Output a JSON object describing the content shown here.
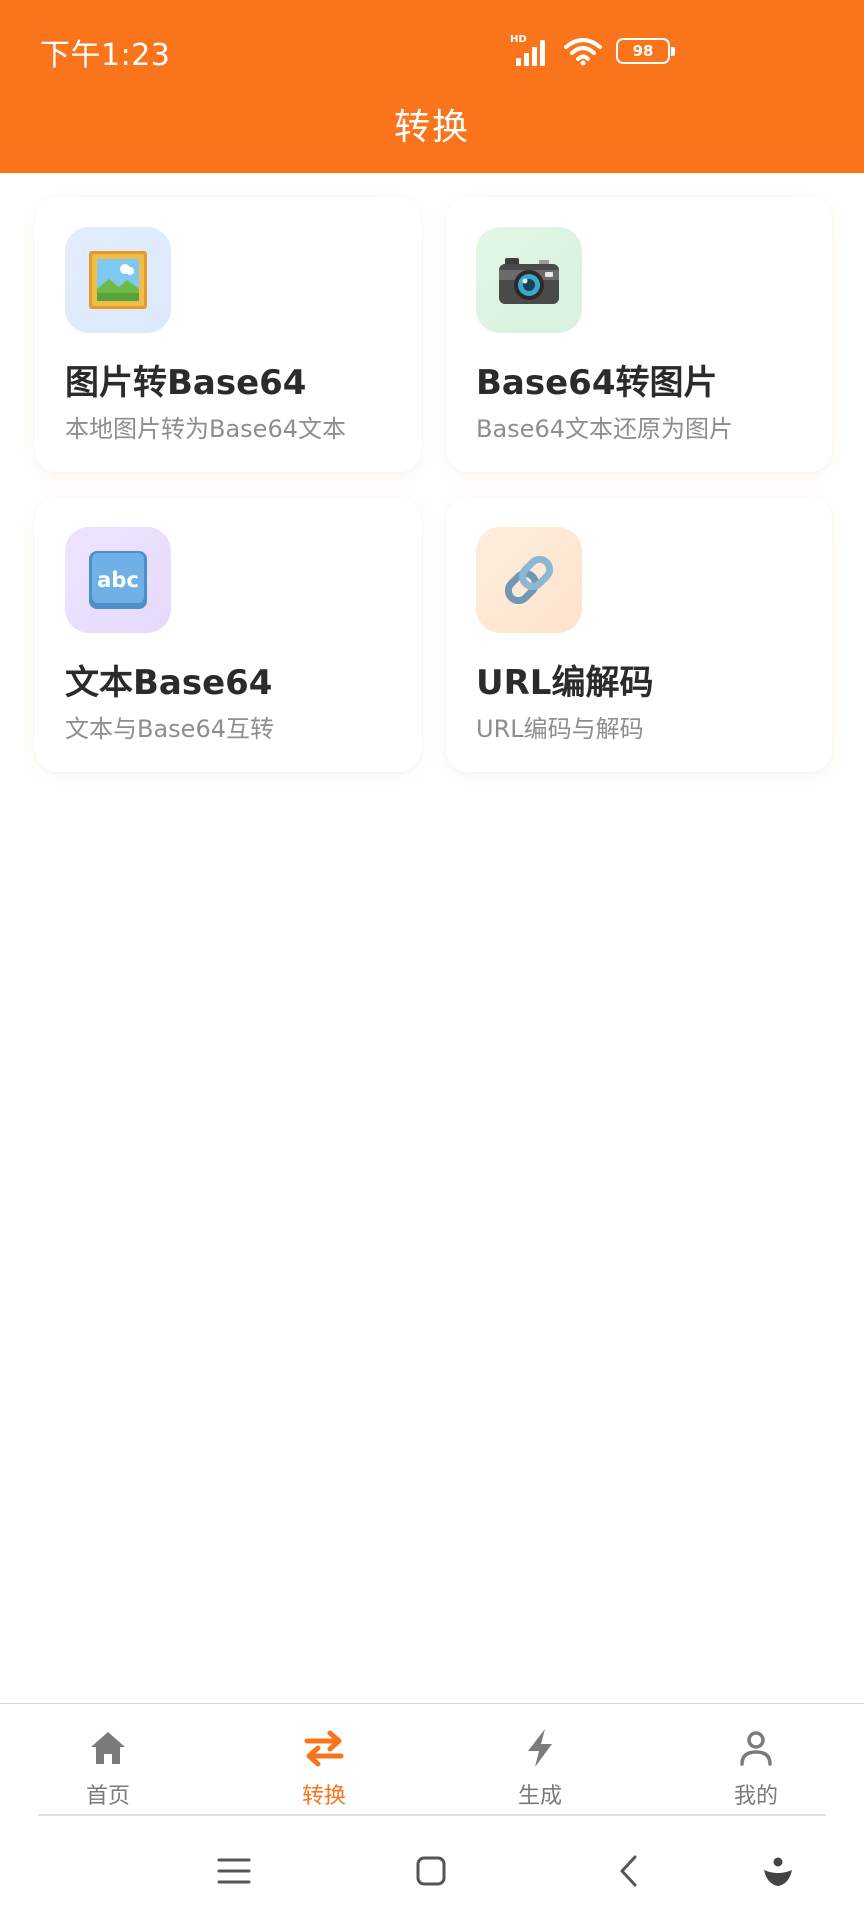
{
  "status_bar": {
    "time": "下午1:23",
    "network_badge": "HD",
    "battery_level": "98",
    "icons": [
      "signal-icon",
      "wifi-icon",
      "battery-icon"
    ]
  },
  "header": {
    "title": "转换",
    "background_color": "#F9741B"
  },
  "cards": [
    {
      "icon": "framed-picture-icon",
      "title": "图片转Base64",
      "description": "本地图片转为Base64文本"
    },
    {
      "icon": "camera-icon",
      "title": "Base64转图片",
      "description": "Base64文本还原为图片"
    },
    {
      "icon": "abc-input-icon",
      "title": "文本Base64",
      "description": "文本与Base64互转"
    },
    {
      "icon": "link-icon",
      "title": "URL编解码",
      "description": "URL编码与解码"
    }
  ],
  "bottom_nav": {
    "active_index": 1,
    "accent_color": "#F9741B",
    "items": [
      {
        "label": "首页",
        "icon": "home-icon"
      },
      {
        "label": "转换",
        "icon": "swap-arrows-icon"
      },
      {
        "label": "生成",
        "icon": "lightning-icon"
      },
      {
        "label": "我的",
        "icon": "person-icon"
      }
    ]
  },
  "system_nav": {
    "icons": [
      "menu-icon",
      "home-square-icon",
      "back-icon",
      "assistant-icon"
    ]
  }
}
